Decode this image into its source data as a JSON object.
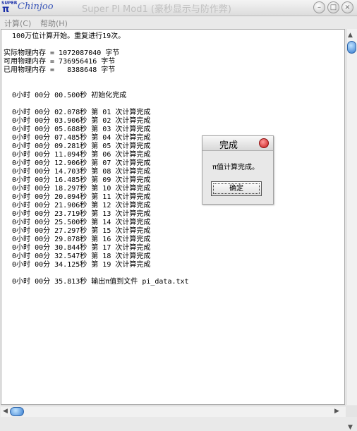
{
  "window": {
    "brand": "Chinjoo",
    "title": "Super PI Mod1 (豪秒显示与防作弊)"
  },
  "menu": [
    {
      "label": "计算(C)"
    },
    {
      "label": "帮助(H)"
    }
  ],
  "output": [
    "  100万位计算开始。重复进行19次。",
    "",
    "实际物理内存 = 1072087040 字节",
    "可用物理内存 = 736956416 字节",
    "已用物理内存 =   8388648 字节",
    "",
    "",
    "  0小时 00分 00.500秒 初始化完成",
    "",
    "  0小时 00分 02.078秒 第 01 次计算完成",
    "  0小时 00分 03.906秒 第 02 次计算完成",
    "  0小时 00分 05.688秒 第 03 次计算完成",
    "  0小时 00分 07.485秒 第 04 次计算完成",
    "  0小时 00分 09.281秒 第 05 次计算完成",
    "  0小时 00分 11.094秒 第 06 次计算完成",
    "  0小时 00分 12.906秒 第 07 次计算完成",
    "  0小时 00分 14.703秒 第 08 次计算完成",
    "  0小时 00分 16.485秒 第 09 次计算完成",
    "  0小时 00分 18.297秒 第 10 次计算完成",
    "  0小时 00分 20.094秒 第 11 次计算完成",
    "  0小时 00分 21.906秒 第 12 次计算完成",
    "  0小时 00分 23.719秒 第 13 次计算完成",
    "  0小时 00分 25.500秒 第 14 次计算完成",
    "  0小时 00分 27.297秒 第 15 次计算完成",
    "  0小时 00分 29.078秒 第 16 次计算完成",
    "  0小时 00分 30.844秒 第 17 次计算完成",
    "  0小时 00分 32.547秒 第 18 次计算完成",
    "  0小时 00分 34.125秒 第 19 次计算完成",
    "",
    "  0小时 00分 35.813秒 输出π值到文件 pi_data.txt"
  ],
  "dialog": {
    "title": "完成",
    "message": "π值计算完成。",
    "ok_label": "确定"
  },
  "colors": {
    "scroll_thumb": "#3b7fd1",
    "close_red": "#c81818"
  }
}
